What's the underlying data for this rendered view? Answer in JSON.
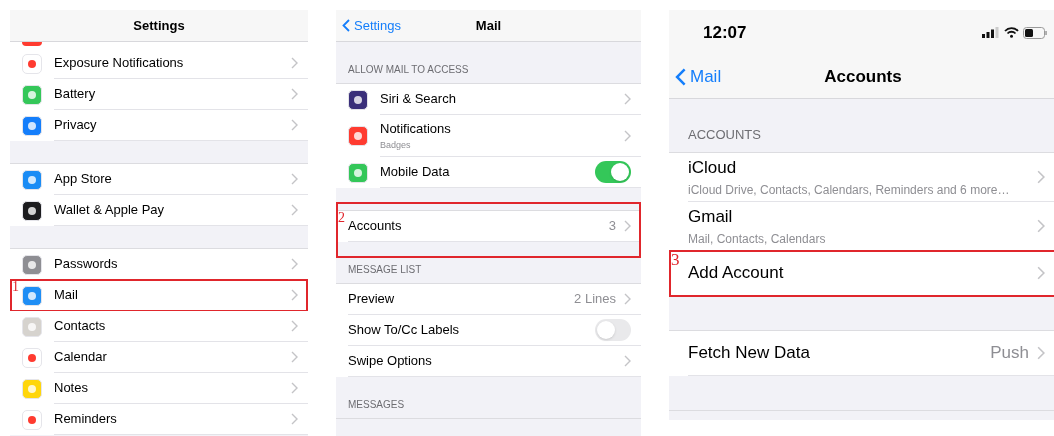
{
  "panels": [
    {
      "kind": "compact",
      "header": {
        "title": "Settings"
      },
      "items": [
        {
          "kind": "cut",
          "color": "#ff3b30"
        },
        {
          "kind": "row",
          "label": "Exposure Notifications",
          "color": "#ffffff"
        },
        {
          "kind": "row",
          "label": "Battery",
          "color": "#34c759"
        },
        {
          "kind": "row",
          "label": "Privacy",
          "color": "#147efb"
        },
        {
          "kind": "gap"
        },
        {
          "kind": "row",
          "label": "App Store",
          "color": "#1a8cf5"
        },
        {
          "kind": "row",
          "label": "Wallet & Apple Pay",
          "color": "#1c1c1e"
        },
        {
          "kind": "gap"
        },
        {
          "kind": "row",
          "label": "Passwords",
          "color": "#8e8e93"
        },
        {
          "kind": "row",
          "label": "Mail",
          "color": "#1e8ef5",
          "annotation": "1"
        },
        {
          "kind": "row",
          "label": "Contacts",
          "color": "#d6d3ce"
        },
        {
          "kind": "row",
          "label": "Calendar",
          "color": "#ffffff"
        },
        {
          "kind": "row",
          "label": "Notes",
          "color": "#ffd60a"
        },
        {
          "kind": "row",
          "label": "Reminders",
          "color": "#ffffff"
        }
      ]
    },
    {
      "kind": "compact",
      "header": {
        "back": "Settings",
        "title": "Mail"
      },
      "items": [
        {
          "kind": "section",
          "label": "ALLOW MAIL TO ACCESS"
        },
        {
          "kind": "row",
          "label": "Siri & Search",
          "color": "#3a2f7a"
        },
        {
          "kind": "row",
          "label": "Notifications",
          "subtitle": "Badges",
          "color": "#ff3b30"
        },
        {
          "kind": "toggle",
          "label": "Mobile Data",
          "color": "#34c759",
          "on": true
        },
        {
          "kind": "gap"
        },
        {
          "kind": "row",
          "label": "Accounts",
          "value": "3",
          "annotation": "2"
        },
        {
          "kind": "section",
          "label": "MESSAGE LIST"
        },
        {
          "kind": "row",
          "label": "Preview",
          "value": "2 Lines"
        },
        {
          "kind": "toggle",
          "label": "Show To/Cc Labels",
          "on": false
        },
        {
          "kind": "row",
          "label": "Swipe Options"
        },
        {
          "kind": "section",
          "label": "MESSAGES"
        }
      ]
    },
    {
      "kind": "large",
      "status": {
        "time": "12:07"
      },
      "header": {
        "back": "Mail",
        "title": "Accounts"
      },
      "items": [
        {
          "kind": "section",
          "label": "ACCOUNTS"
        },
        {
          "kind": "row",
          "label": "iCloud",
          "subtitle": "iCloud Drive, Contacts, Calendars, Reminders and 6 more…"
        },
        {
          "kind": "row",
          "label": "Gmail",
          "subtitle": "Mail, Contacts, Calendars"
        },
        {
          "kind": "row",
          "label": "Add Account",
          "annotation": "3"
        },
        {
          "kind": "gap"
        },
        {
          "kind": "row",
          "label": "Fetch New Data",
          "value": "Push"
        },
        {
          "kind": "gap"
        }
      ]
    }
  ]
}
